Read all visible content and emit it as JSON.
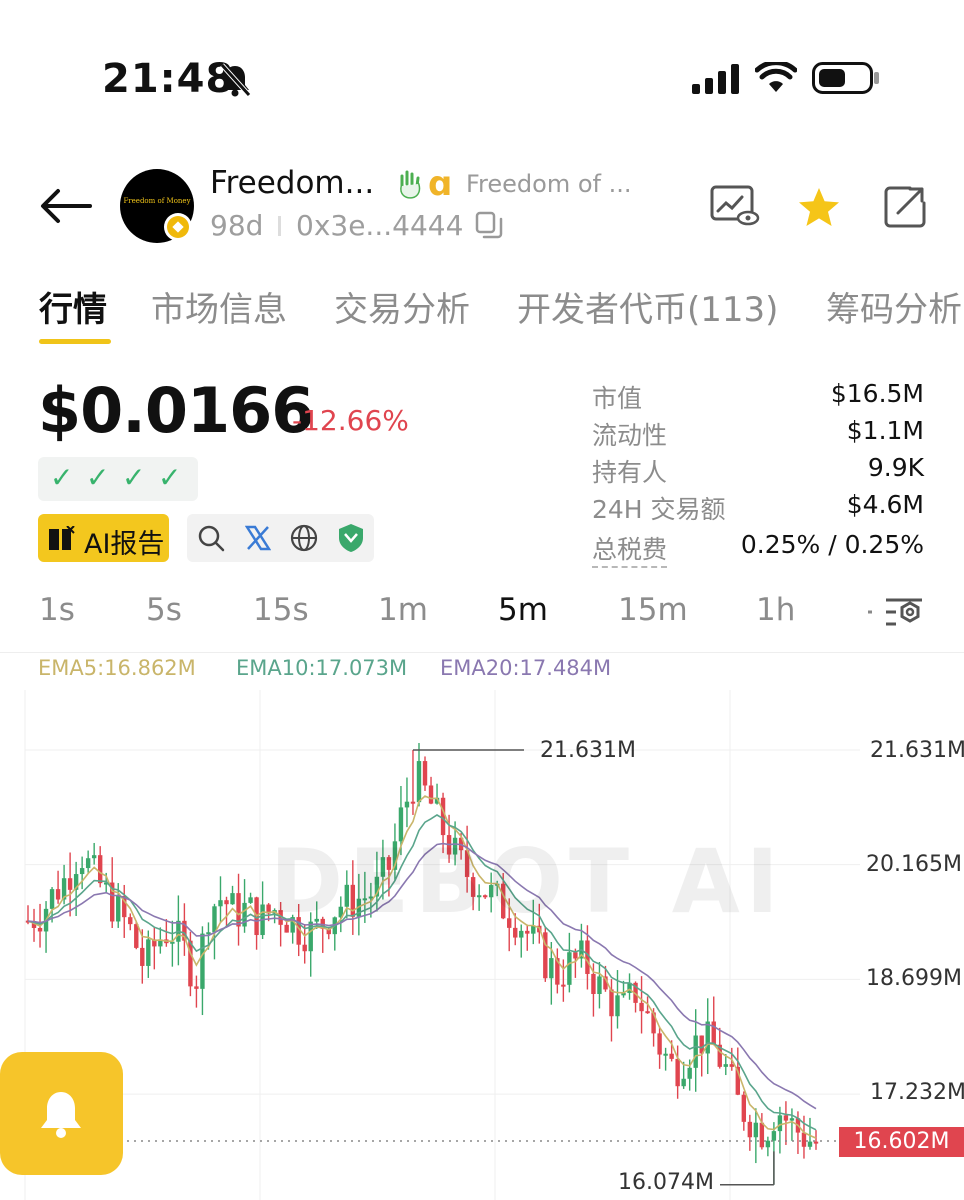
{
  "status_bar": {
    "time": "21:48",
    "icons": [
      "bell-muted-icon",
      "signal-icon",
      "wifi-icon",
      "battery-icon"
    ]
  },
  "header": {
    "token_name": "Freedom...",
    "token_full_name": "Freedom of ...",
    "avatar_text": "Freedom of Money",
    "age": "98d",
    "address": "0x3e...4444",
    "action_icons": [
      "watch-chart-icon",
      "star-icon",
      "share-icon"
    ],
    "colors": {
      "star": "#f5c518",
      "accent": "#f0c419"
    }
  },
  "tabs": [
    {
      "label": "行情",
      "active": true
    },
    {
      "label": "市场信息",
      "active": false
    },
    {
      "label": "交易分析",
      "active": false
    },
    {
      "label": "开发者代币(113)",
      "active": false
    },
    {
      "label": "筹码分析",
      "active": false
    }
  ],
  "price": {
    "value": "$0.0166",
    "change": "-12.66%",
    "checks": [
      "✓",
      "✓",
      "✓",
      "✓"
    ],
    "ai_button": "AI报告",
    "quick_icons": [
      "search-icon",
      "x-icon",
      "globe-icon",
      "shield-logo-icon"
    ]
  },
  "stats": [
    {
      "label": "市值",
      "value": "$16.5M"
    },
    {
      "label": "流动性",
      "value": "$1.1M"
    },
    {
      "label": "持有人",
      "value": "9.9K"
    },
    {
      "label": "24H 交易额",
      "value": "$4.6M"
    },
    {
      "label": "总税费",
      "value": "0.25% / 0.25%"
    }
  ],
  "intervals": [
    {
      "label": "1s",
      "active": false
    },
    {
      "label": "5s",
      "active": false
    },
    {
      "label": "15s",
      "active": false
    },
    {
      "label": "1m",
      "active": false
    },
    {
      "label": "5m",
      "active": true
    },
    {
      "label": "15m",
      "active": false
    },
    {
      "label": "1h",
      "active": false
    }
  ],
  "ema": {
    "ema5": "EMA5:16.862M",
    "ema10": "EMA10:17.073M",
    "ema20": "EMA20:17.484M",
    "colors": {
      "ema5": "#c9b56a",
      "ema10": "#5aa58c",
      "ema20": "#8a78b0"
    }
  },
  "chart_data": {
    "type": "candlestick",
    "y_ticks": [
      "21.631M",
      "20.165M",
      "18.699M",
      "17.232M"
    ],
    "y_tick_values": [
      21.631,
      20.165,
      18.699,
      17.232
    ],
    "high_marker": "21.631M",
    "low_marker": "16.074M",
    "current_price": "16.602M",
    "ylim": [
      15.5,
      22.3
    ],
    "watermark": "DEBOT AI",
    "colors": {
      "up": "#3aa86b",
      "down": "#e0454f"
    },
    "close_path": [
      19.45,
      19.55,
      19.8,
      20.0,
      20.35,
      20.05,
      19.8,
      19.55,
      19.3,
      18.85,
      19.2,
      19.35,
      19.1,
      18.7,
      19.6,
      19.75,
      19.55,
      19.6,
      19.45,
      19.6,
      19.5,
      19.35,
      19.3,
      19.45,
      19.65,
      19.7,
      19.75,
      19.85,
      20.15,
      20.85,
      21.3,
      21.0,
      20.65,
      20.3,
      20.05,
      19.9,
      19.75,
      19.6,
      19.45,
      19.2,
      18.95,
      18.75,
      18.9,
      18.95,
      18.65,
      18.45,
      18.3,
      18.55,
      18.2,
      17.8,
      17.55,
      17.75,
      17.95,
      17.85,
      17.55,
      17.1,
      16.9,
      16.75,
      17.05,
      16.85,
      16.7,
      16.6
    ]
  },
  "floating": {
    "bell_icon": "bell-icon"
  }
}
